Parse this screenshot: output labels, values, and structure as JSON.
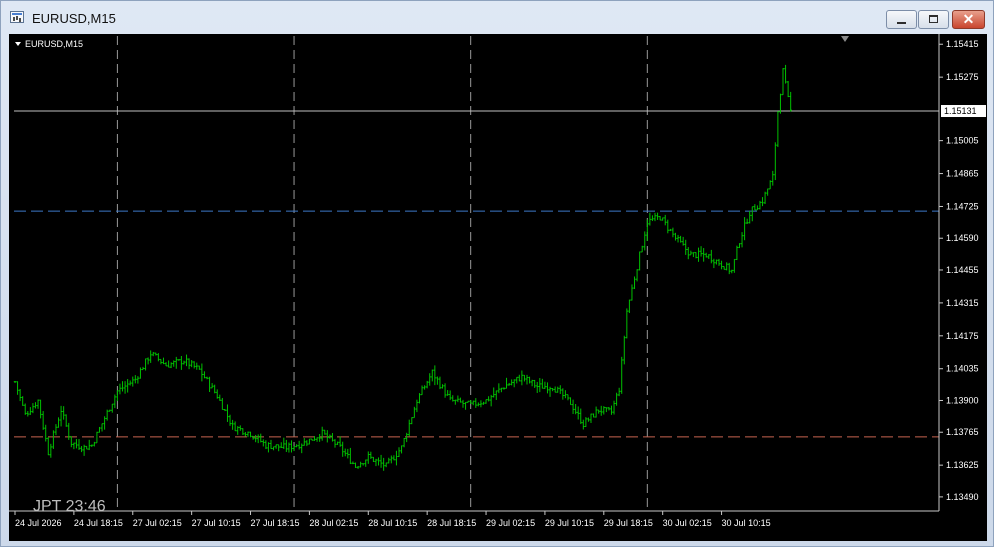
{
  "window": {
    "title": "EURUSD,M15",
    "icon": "chart-window-icon",
    "controls": {
      "minimize": "minimize-icon",
      "maximize": "maximize-icon",
      "close_glyph": "✕"
    }
  },
  "chart_data": {
    "type": "bar",
    "style": "ohlc",
    "symbol_label": "EURUSD,M15",
    "clock_label": "JPT 23:46",
    "bar_color": "#00c000",
    "background": "#000000",
    "grid": true,
    "bid_line": {
      "value": 1.15131,
      "label": "1.15131",
      "color": "#c0c0c0"
    },
    "hlines": [
      {
        "value": 1.14705,
        "color": "#3c78c8"
      },
      {
        "value": 1.13745,
        "color": "#c86450"
      }
    ],
    "ylim": [
      1.1343,
      1.1545
    ],
    "y_ticks": [
      {
        "value": 1.15415,
        "label": "1.15415"
      },
      {
        "value": 1.15275,
        "label": "1.15275"
      },
      {
        "value": 1.15005,
        "label": "1.15005"
      },
      {
        "value": 1.14865,
        "label": "1.14865"
      },
      {
        "value": 1.14725,
        "label": "1.14725"
      },
      {
        "value": 1.1459,
        "label": "1.14590"
      },
      {
        "value": 1.14455,
        "label": "1.14455"
      },
      {
        "value": 1.14315,
        "label": "1.14315"
      },
      {
        "value": 1.14175,
        "label": "1.14175"
      },
      {
        "value": 1.14035,
        "label": "1.14035"
      },
      {
        "value": 1.139,
        "label": "1.13900"
      },
      {
        "value": 1.13765,
        "label": "1.13765"
      },
      {
        "value": 1.13625,
        "label": "1.13625"
      },
      {
        "value": 1.1349,
        "label": "1.13490"
      }
    ],
    "x_count": 332,
    "x_ticks": [
      {
        "index": 0,
        "label": "24 Jul 2026"
      },
      {
        "index": 23,
        "label": "24 Jul 18:15"
      },
      {
        "index": 46,
        "label": "27 Jul 02:15"
      },
      {
        "index": 69,
        "label": "27 Jul 10:15"
      },
      {
        "index": 92,
        "label": "27 Jul 18:15"
      },
      {
        "index": 115,
        "label": "28 Jul 02:15"
      },
      {
        "index": 138,
        "label": "28 Jul 10:15"
      },
      {
        "index": 161,
        "label": "28 Jul 18:15"
      },
      {
        "index": 184,
        "label": "29 Jul 02:15"
      },
      {
        "index": 207,
        "label": "29 Jul 10:15"
      },
      {
        "index": 230,
        "label": "29 Jul 18:15"
      },
      {
        "index": 253,
        "label": "30 Jul 02:15"
      },
      {
        "index": 276,
        "label": "30 Jul 10:15"
      }
    ],
    "session_breaks": [
      40,
      109,
      178,
      247
    ],
    "close_path": [
      [
        0,
        1.1398
      ],
      [
        4,
        1.1384
      ],
      [
        9,
        1.139
      ],
      [
        13,
        1.1368
      ],
      [
        18,
        1.1386
      ],
      [
        22,
        1.1372
      ],
      [
        27,
        1.137
      ],
      [
        30,
        1.1371
      ],
      [
        40,
        1.1394
      ],
      [
        47,
        1.1399
      ],
      [
        53,
        1.141
      ],
      [
        59,
        1.1405
      ],
      [
        66,
        1.1407
      ],
      [
        72,
        1.1403
      ],
      [
        79,
        1.1392
      ],
      [
        85,
        1.1379
      ],
      [
        92,
        1.1376
      ],
      [
        98,
        1.1371
      ],
      [
        106,
        1.137
      ],
      [
        113,
        1.1372
      ],
      [
        120,
        1.1376
      ],
      [
        127,
        1.137
      ],
      [
        133,
        1.1362
      ],
      [
        138,
        1.1366
      ],
      [
        145,
        1.1362
      ],
      [
        151,
        1.137
      ],
      [
        157,
        1.139
      ],
      [
        163,
        1.1402
      ],
      [
        170,
        1.139
      ],
      [
        178,
        1.1388
      ],
      [
        184,
        1.139
      ],
      [
        191,
        1.1396
      ],
      [
        198,
        1.14
      ],
      [
        204,
        1.1396
      ],
      [
        210,
        1.1396
      ],
      [
        217,
        1.1389
      ],
      [
        222,
        1.138
      ],
      [
        228,
        1.1386
      ],
      [
        233,
        1.1385
      ],
      [
        236,
        1.1395
      ],
      [
        239,
        1.1428
      ],
      [
        243,
        1.1447
      ],
      [
        247,
        1.1466
      ],
      [
        252,
        1.1468
      ],
      [
        258,
        1.1459
      ],
      [
        264,
        1.1452
      ],
      [
        270,
        1.1452
      ],
      [
        276,
        1.1448
      ],
      [
        280,
        1.1445
      ],
      [
        283,
        1.1458
      ],
      [
        287,
        1.147
      ],
      [
        292,
        1.1475
      ],
      [
        296,
        1.1485
      ],
      [
        298,
        1.1513
      ],
      [
        300,
        1.153
      ],
      [
        302,
        1.1518
      ],
      [
        303,
        1.1513
      ]
    ],
    "wiggle": 0.0003,
    "bar_range": 0.0004
  }
}
